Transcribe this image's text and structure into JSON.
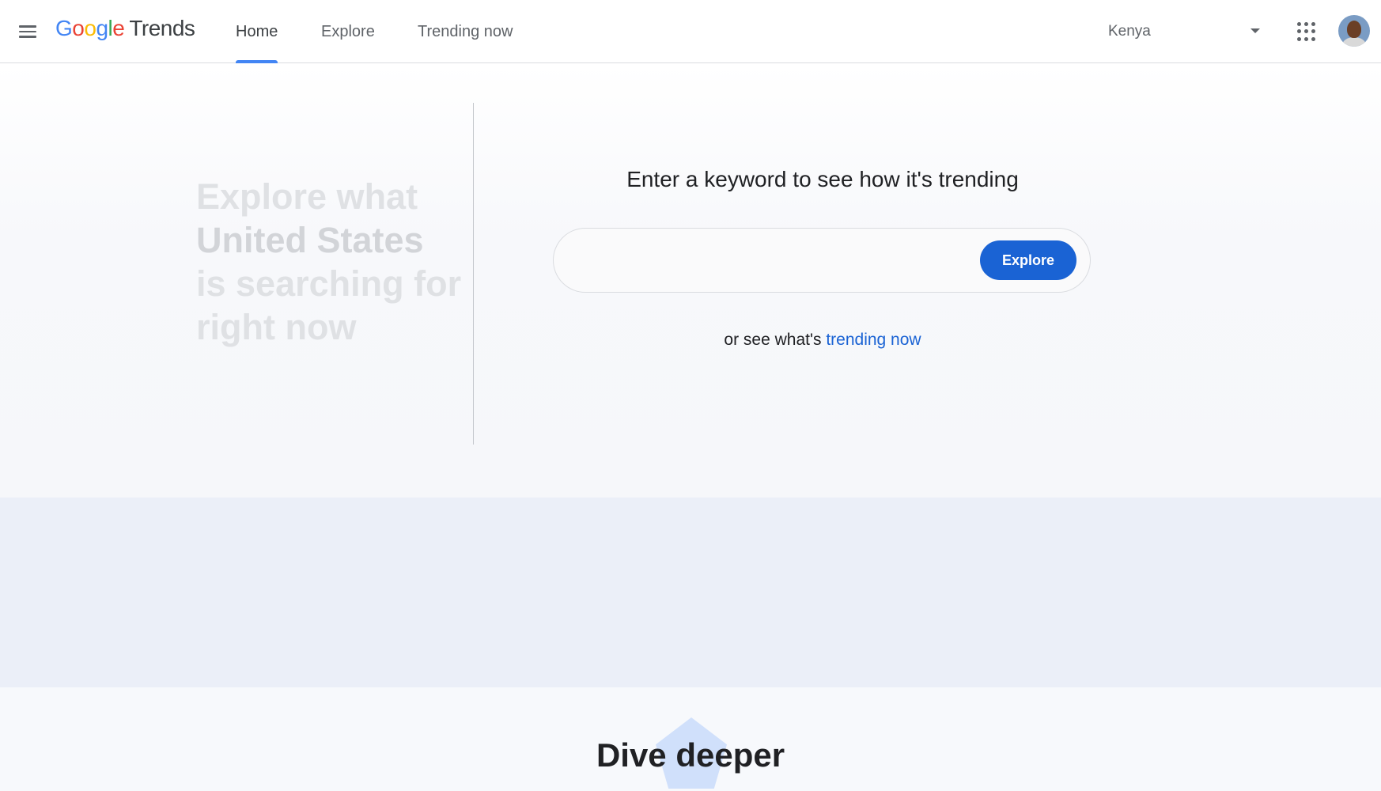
{
  "header": {
    "logo": {
      "google": [
        "G",
        "o",
        "o",
        "g",
        "l",
        "e"
      ],
      "product": "Trends"
    },
    "nav": [
      {
        "label": "Home",
        "active": true
      },
      {
        "label": "Explore",
        "active": false
      },
      {
        "label": "Trending now",
        "active": false
      }
    ],
    "region": {
      "selected": "Kenya"
    },
    "icons": {
      "menu": "hamburger-menu-icon",
      "apps": "apps-grid-icon",
      "region_caret": "caret-down-icon"
    }
  },
  "hero": {
    "headline": {
      "line1": "Explore what",
      "country": "United States",
      "line3": "is searching for",
      "line4": "right now"
    },
    "prompt": "Enter a keyword to see how it's trending",
    "search": {
      "value": "",
      "placeholder": ""
    },
    "explore_button": "Explore",
    "trending_prefix": "or see what's",
    "trending_link": "trending now"
  },
  "dive": {
    "title": "Dive deeper"
  },
  "colors": {
    "accent": "#1a63d4",
    "nav_underline": "#4285f4",
    "band": "#ebeff8",
    "logo": [
      "#4285f4",
      "#ea4335",
      "#fbbc05",
      "#4285f4",
      "#34a853",
      "#ea4335"
    ]
  }
}
